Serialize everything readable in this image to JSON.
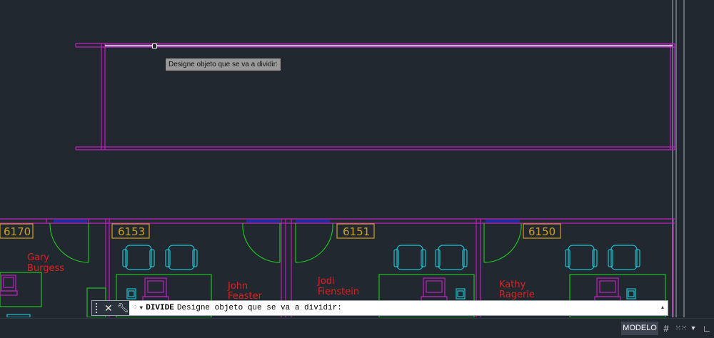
{
  "tooltip": {
    "text": "Designe objeto que se va a dividir:"
  },
  "rooms": [
    {
      "number": "6170",
      "occupant_line1": "Gary",
      "occupant_line2": "Burgess"
    },
    {
      "number": "6153",
      "occupant_line1": "John",
      "occupant_line2": "Feaster"
    },
    {
      "number": "6151",
      "occupant_line1": "Jodi",
      "occupant_line2": "Fienstein"
    },
    {
      "number": "6150",
      "occupant_line1": "Kathy",
      "occupant_line2": "Ragerie"
    }
  ],
  "command_line": {
    "command": "DIVIDE",
    "prompt": "Designe objeto que se va a dividir:"
  },
  "statusbar": {
    "model_tab": "MODELO"
  },
  "colors": {
    "background": "#212830",
    "wall": "#c020c0",
    "door": "#20c020",
    "furniture_chair": "#20c0d0",
    "room_tag": "#d0a020",
    "occupant_text": "#e02020",
    "window": "#2030c0",
    "monitor": "#c020c0"
  },
  "icons": {
    "close": "close-icon",
    "customize": "wrench-icon",
    "recent_commands": "recent-commands-icon",
    "grid": "grid-icon",
    "snap": "snap-icon",
    "menu": "chevron-down-icon",
    "ortho": "ortho-icon"
  }
}
